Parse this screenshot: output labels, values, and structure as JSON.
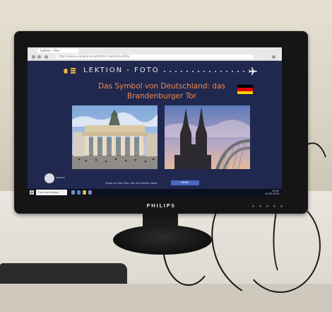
{
  "browser": {
    "tab_title": "Lektion - Foto",
    "address": "https://www.example-lernplattform.de/lektion/foto"
  },
  "site": {
    "header_title": "LEKTION - FOTO",
    "headline_line1": "Das Symbol von Deutschland: das",
    "headline_line2": "Brandenburger Tor",
    "flag_colors": [
      "#000000",
      "#dd0000",
      "#ffce00"
    ],
    "accent_color": "#f4b642",
    "headline_color": "#f08a4e",
    "background_color": "#20284f",
    "photos": [
      {
        "name": "Brandenburger Tor"
      },
      {
        "name": "Kölner Dom"
      }
    ],
    "footer_caption": "Zeige auf das Foto, das am besten passt.",
    "footer_button": "Weiter",
    "logo_text": "speexx"
  },
  "taskbar": {
    "search_placeholder": "Frag mich etwas",
    "time": "10:42",
    "date": "14.03.2018"
  },
  "monitor": {
    "brand": "PHILIPS"
  },
  "icons": [
    "home-icon",
    "menu-icon",
    "plane-icon",
    "windows-start-icon"
  ]
}
